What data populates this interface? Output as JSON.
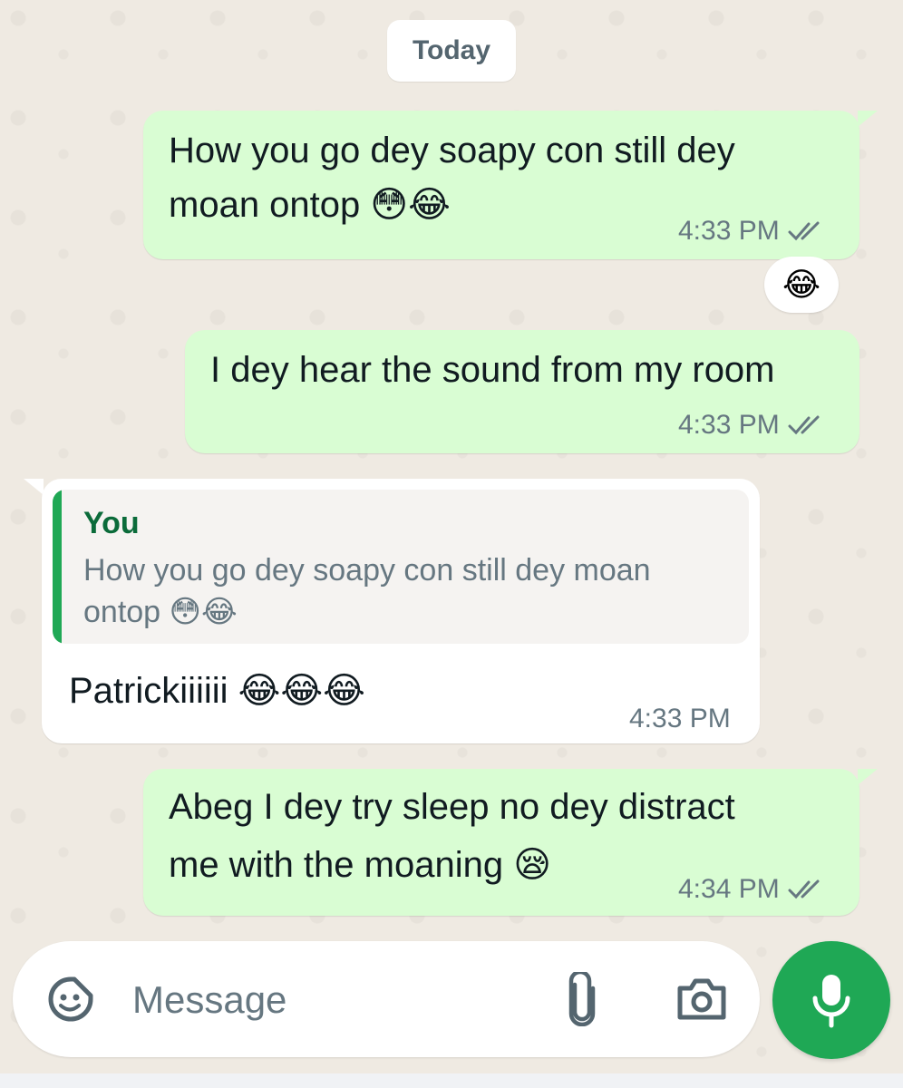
{
  "date_chip": "Today",
  "messages": [
    {
      "line1": "How you go dey soapy con still dey",
      "line2": "moan ontop 😳😂",
      "time": "4:33 PM",
      "reaction": "😂"
    },
    {
      "text": "I dey hear the sound from my room",
      "time": "4:33 PM"
    },
    {
      "quote_name": "You",
      "quote_line1": "How you go dey soapy con still dey moan",
      "quote_line2": "ontop 😳😂",
      "text": "Patrickiiiiii 😂😂😂",
      "time": "4:33 PM"
    },
    {
      "line1": "Abeg I dey try sleep no dey distract",
      "line2": "me with the moaning 😪",
      "time": "4:34 PM"
    }
  ],
  "composer": {
    "placeholder": "Message"
  },
  "icons": {
    "sticker": "sticker-icon",
    "attach": "paperclip-icon",
    "camera": "camera-icon",
    "mic": "microphone-icon",
    "read": "double-check-icon"
  },
  "colors": {
    "outgoing_bubble": "#d9fdd3",
    "incoming_bubble": "#ffffff",
    "accent": "#1fa855",
    "background": "#efeae2"
  }
}
